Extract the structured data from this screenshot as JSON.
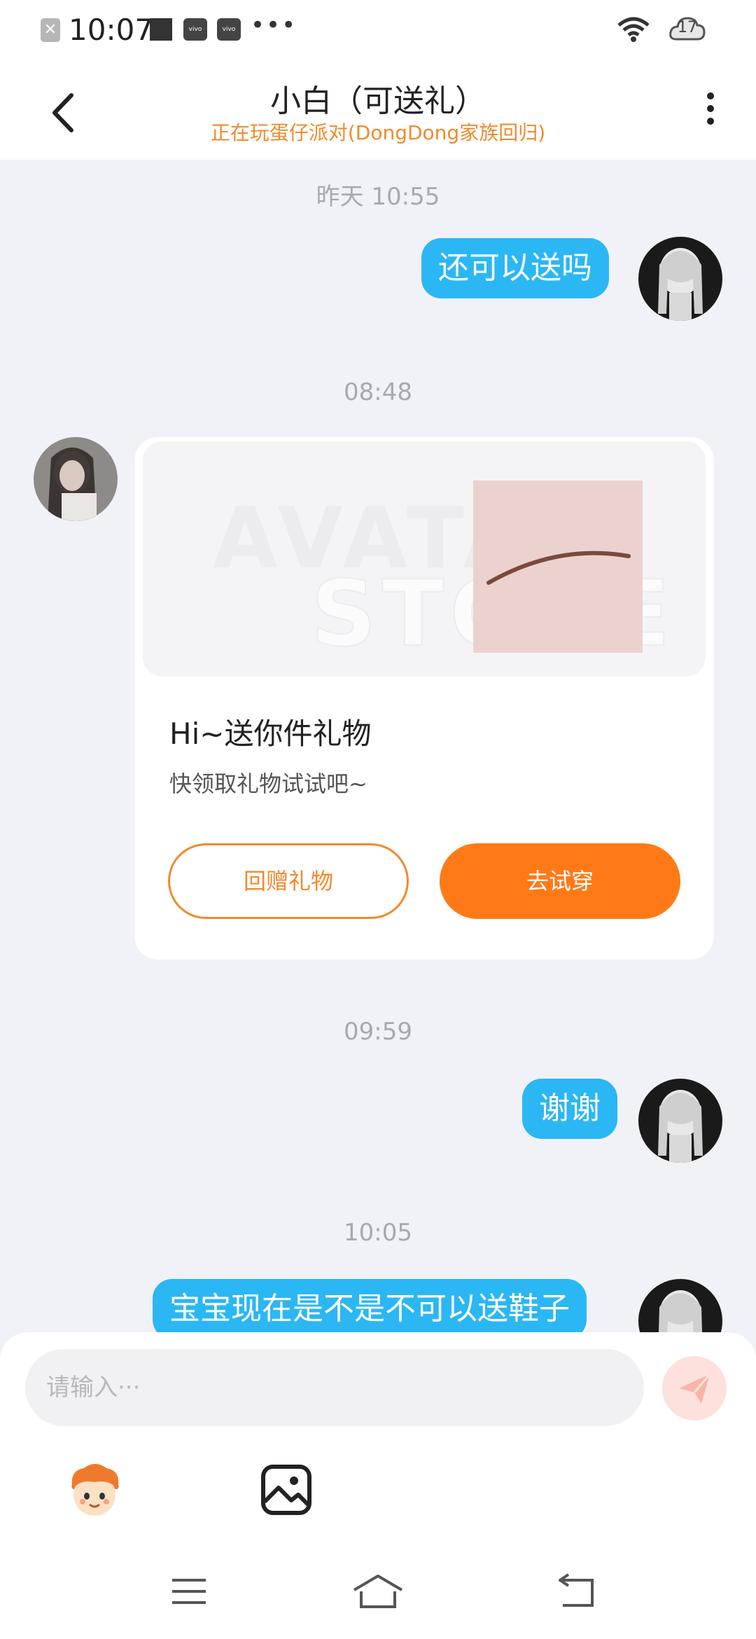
{
  "status_bar": {
    "time": "10:07",
    "dots": "•••",
    "battery_level": "17",
    "notif_x_glyph": "✕",
    "vivo_label": "vivo"
  },
  "header": {
    "back_icon": "chevron-left",
    "title": "小白（可送礼）",
    "subtitle": "正在玩蛋仔派对(DongDong家族回归)",
    "more_icon": "vertical-dots"
  },
  "messages": {
    "ts1": "昨天 10:55",
    "m1": "还可以送吗",
    "ts2": "08:48",
    "gift_card": {
      "watermark_line1": "AVATAR",
      "watermark_line2": "STORE",
      "title": "Hi~送你件礼物",
      "description": "快领取礼物试试吧~",
      "return_gift_label": "回赠礼物",
      "try_on_label": "去试穿"
    },
    "ts3": "09:59",
    "m2": "谢谢",
    "ts4": "10:05",
    "m3": "宝宝现在是不是不可以送鞋子"
  },
  "input": {
    "placeholder": "请输入···"
  },
  "colors": {
    "accent_orange": "#ff7a17",
    "bubble_blue": "#2bb7f3",
    "subtitle_orange": "#f08a2c"
  }
}
